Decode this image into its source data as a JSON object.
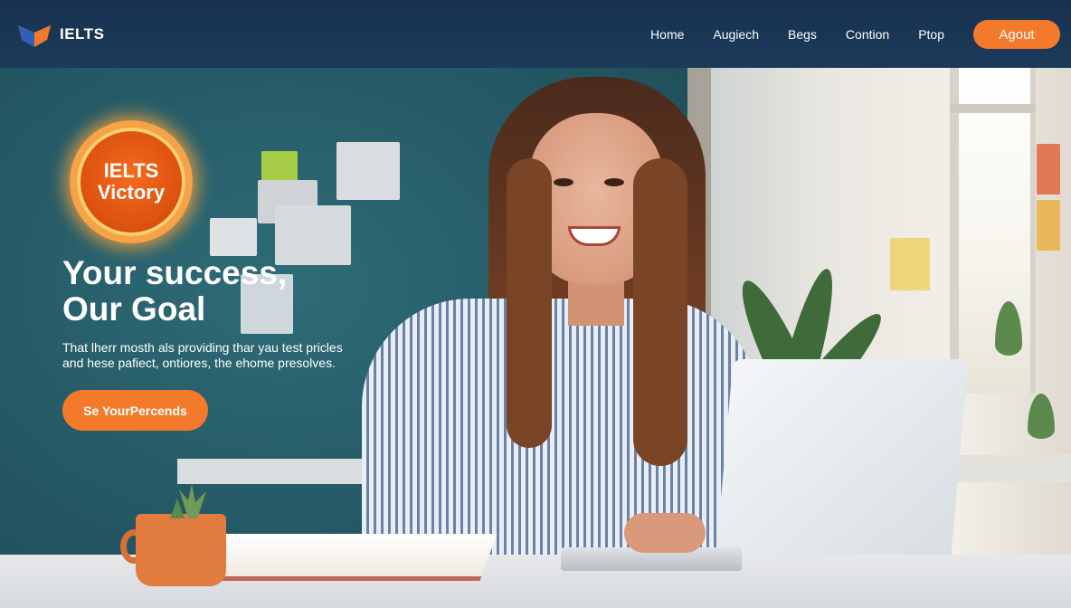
{
  "header": {
    "logo_text": "IELTS",
    "nav": [
      {
        "label": "Home"
      },
      {
        "label": "Augiech"
      },
      {
        "label": "Begs"
      },
      {
        "label": "Contion"
      },
      {
        "label": "Ptop"
      }
    ],
    "cta_label": "Agout"
  },
  "hero": {
    "badge_line1": "IELTS",
    "badge_line2": "Victory",
    "headline_line1": "Your success,",
    "headline_line2": "Our Goal",
    "subtext_line1": "That lherr mosth als providing thar yau test pricles",
    "subtext_line2": "and hese pafiect, ontiores, the ehome presolves.",
    "cta_label": "Se YourPercends"
  },
  "colors": {
    "header_bg": "#17324f",
    "accent_orange": "#f37a2b",
    "wall_teal": "#2e6c78"
  }
}
